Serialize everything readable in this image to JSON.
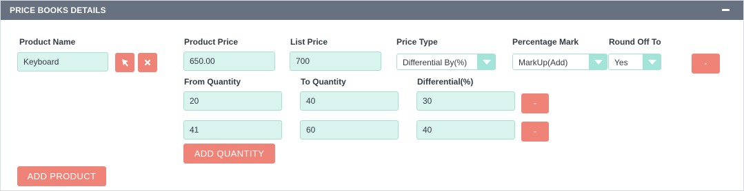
{
  "panel": {
    "title": "PRICE BOOKS DETAILS",
    "collapse_icon": "minus-icon"
  },
  "labels": {
    "product_name": "Product Name",
    "product_price": "Product Price",
    "list_price": "List Price",
    "price_type": "Price Type",
    "percentage_mark": "Percentage Mark",
    "round_off_to": "Round Off To",
    "from_quantity": "From Quantity",
    "to_quantity": "To Quantity",
    "differential": "Differential(%)"
  },
  "product": {
    "name": "Keyboard",
    "price": "650.00",
    "list_price": "700",
    "price_type": "Differential By(%)",
    "percentage_mark": "MarkUp(Add)",
    "round_off_to": "Yes"
  },
  "quantities": [
    {
      "from": "20",
      "to": "40",
      "differential": "30"
    },
    {
      "from": "41",
      "to": "60",
      "differential": "40"
    }
  ],
  "buttons": {
    "remove_label": "-",
    "add_quantity": "ADD QUANTITY",
    "add_product": "ADD PRODUCT"
  },
  "colors": {
    "header": "#67717f",
    "field_bg": "#d9f4ee",
    "button": "#f08377",
    "select_arrow": "#a2e4d7"
  }
}
